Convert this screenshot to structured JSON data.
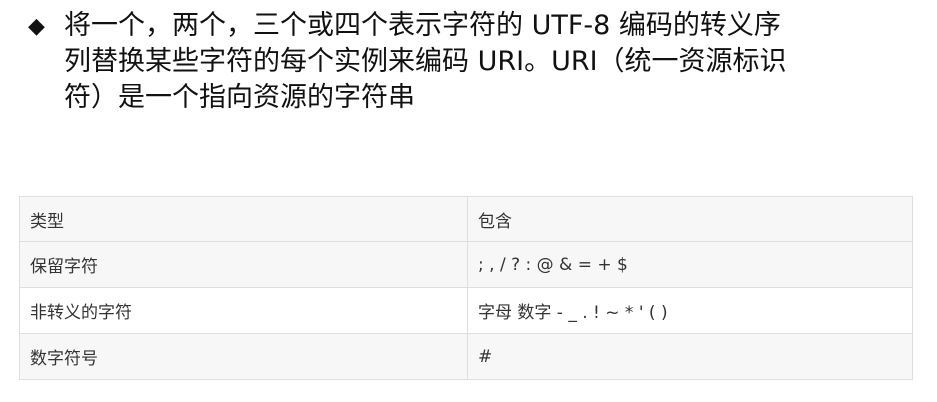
{
  "bullet": {
    "icon": "diamond-bullet-icon",
    "lines": [
      "将一个，两个，三个或四个表示字符的 UTF-8 编码的转义序",
      "列替换某些字符的每个实例来编码 URI。URI（统一资源标识",
      "符）是一个指向资源的字符串"
    ]
  },
  "table": {
    "headers": [
      "类型",
      "包含"
    ],
    "rows": [
      [
        "保留字符",
        "; , / ? : @ & = + $"
      ],
      [
        "非转义的字符",
        "字母 数字 - _ . ! ~ * ' ( )"
      ],
      [
        "数字符号",
        "#"
      ]
    ]
  }
}
